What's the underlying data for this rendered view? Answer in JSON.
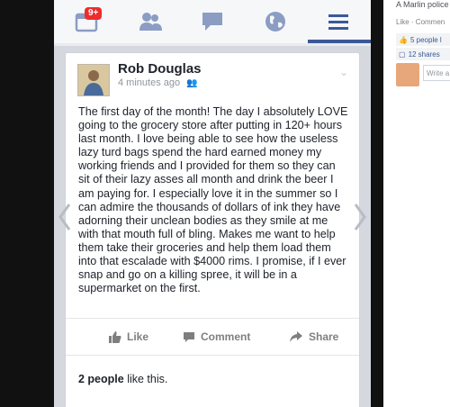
{
  "nav": {
    "notification_badge": "9+",
    "icons": [
      "news-feed-icon",
      "friends-icon",
      "messages-icon",
      "globe-icon",
      "menu-icon"
    ]
  },
  "post": {
    "author": "Rob Douglas",
    "time": "4 minutes ago",
    "text": "The first day of the month! The day I absolutely LOVE going to the grocery store after putting in 120+ hours last month. I love being able to see how the useless lazy turd bags spend the hard earned money my working friends and I provided for them so they can sit of their lazy asses all month and drink the beer I am paying for. I especially love it in the summer so I can admire the thousands of dollars of ink they have adorning their unclean bodies as they smile at me with that mouth full of bling. Makes me want to help them take their groceries and help them load them into that escalade with $4000 rims. I promise, if I ever snap and go on a killing spree, it will be in a supermarket on the first.",
    "actions": {
      "like": "Like",
      "comment": "Comment",
      "share": "Share"
    },
    "likes_count": "2 people",
    "likes_suffix": " like this."
  },
  "side": {
    "title": "A Marlin police",
    "meta": "Like · Commen",
    "likes": "5 people l",
    "shares": "12 shares",
    "write_placeholder": "Write a"
  },
  "colors": {
    "brand_blue": "#3b5998",
    "badge_red": "#ee2c2c",
    "screen_bg": "#d5d8de"
  }
}
